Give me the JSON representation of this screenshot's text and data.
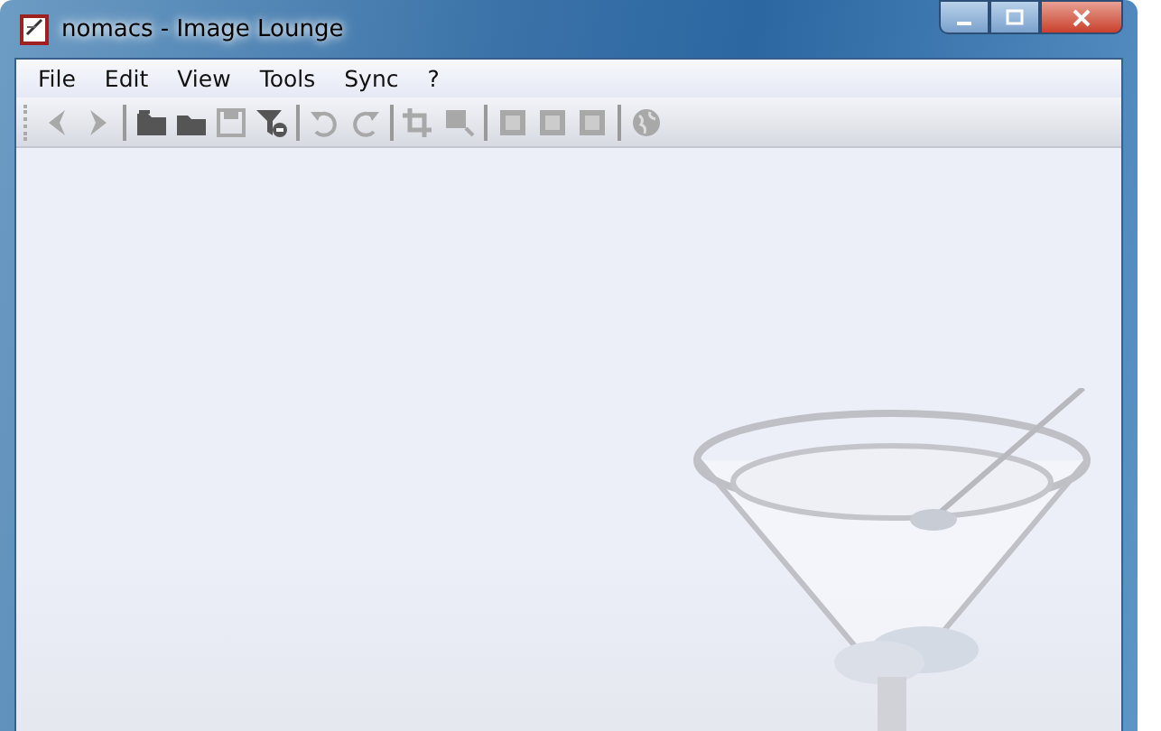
{
  "window": {
    "title": "nomacs - Image Lounge"
  },
  "menu": [
    "File",
    "Edit",
    "View",
    "Tools",
    "Sync",
    "?"
  ],
  "toolbar": [
    {
      "kind": "back",
      "disabled": true
    },
    {
      "kind": "forward",
      "disabled": true
    },
    {
      "kind": "sep"
    },
    {
      "kind": "open",
      "disabled": false
    },
    {
      "kind": "folder",
      "disabled": false
    },
    {
      "kind": "save",
      "disabled": true
    },
    {
      "kind": "filter",
      "disabled": false
    },
    {
      "kind": "sep"
    },
    {
      "kind": "rotate-left",
      "disabled": true
    },
    {
      "kind": "rotate-right",
      "disabled": true
    },
    {
      "kind": "sep"
    },
    {
      "kind": "crop",
      "disabled": true
    },
    {
      "kind": "resize",
      "disabled": true
    },
    {
      "kind": "sep"
    },
    {
      "kind": "fullscreen",
      "disabled": true
    },
    {
      "kind": "fit",
      "disabled": true
    },
    {
      "kind": "actual-size",
      "disabled": true
    },
    {
      "kind": "sep"
    },
    {
      "kind": "globe",
      "disabled": true
    }
  ]
}
